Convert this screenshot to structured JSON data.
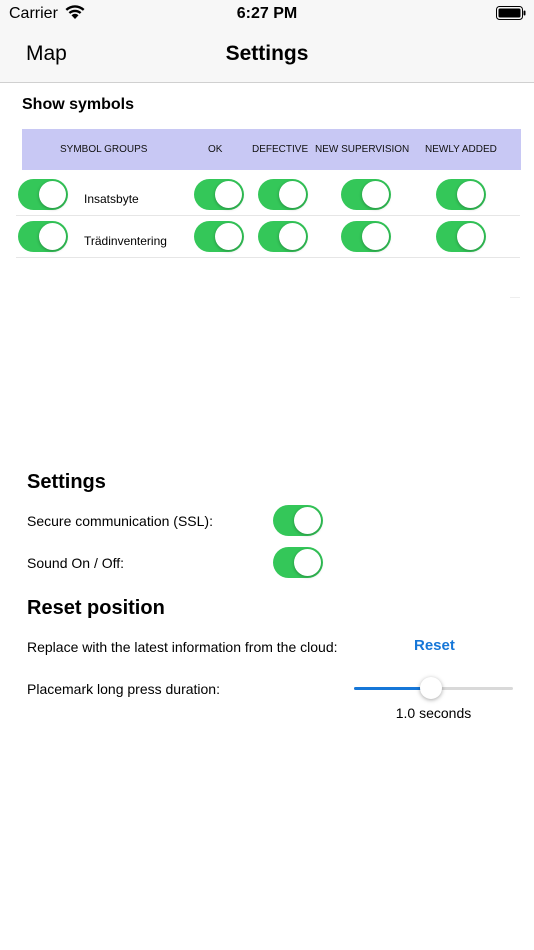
{
  "status_bar": {
    "carrier": "Carrier",
    "time": "6:27 PM",
    "icons": [
      "wifi-icon",
      "battery-icon"
    ]
  },
  "nav": {
    "back_label": "Map",
    "title": "Settings"
  },
  "symbols": {
    "title": "Show symbols",
    "header_color": "#c8c8f4",
    "columns": [
      "SYMBOL GROUPS",
      "OK",
      "DEFECTIVE",
      "NEW SUPERVISION",
      "NEWLY ADDED"
    ],
    "rows": [
      {
        "label": "Insatsbyte",
        "group_on": true,
        "ok": true,
        "defective": true,
        "new_supervision": true,
        "newly_added": true
      },
      {
        "label": "Trädinventering",
        "group_on": true,
        "ok": true,
        "defective": true,
        "new_supervision": true,
        "newly_added": true
      }
    ]
  },
  "settings": {
    "title": "Settings",
    "ssl_label": "Secure communication (SSL):",
    "ssl_on": true,
    "sound_label": "Sound On / Off:",
    "sound_on": true
  },
  "reset": {
    "title": "Reset position",
    "replace_label": "Replace with the latest information from the cloud:",
    "button_label": "Reset",
    "press_label": "Placemark long press duration:",
    "slider_fraction": 0.48,
    "slider_value_text": "1.0 seconds"
  },
  "colors": {
    "switch_on": "#34c759",
    "accent": "#1677d8"
  }
}
